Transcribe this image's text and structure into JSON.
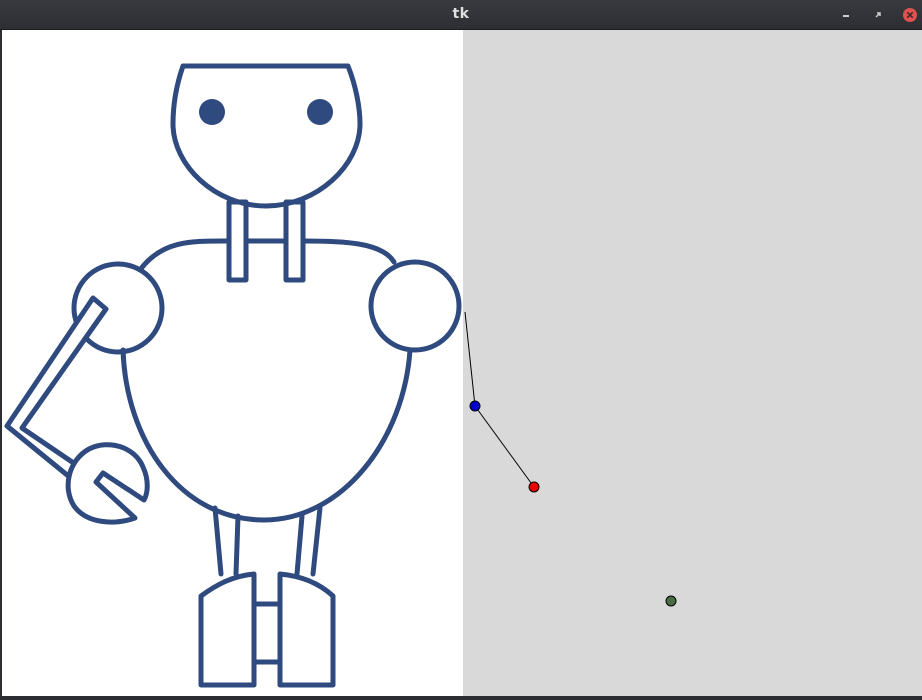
{
  "window": {
    "title": "tk",
    "buttons": {
      "minimize": "minimize-icon",
      "maximize": "maximize-icon",
      "close": "close-icon"
    }
  },
  "colors": {
    "titlebar": "#2f3035",
    "canvas_bg": "#d9d9d9",
    "image_bg": "#ffffff",
    "robot_stroke": "#2f4a7f",
    "close_button": "#e0514f",
    "point_blue": "#0000cc",
    "point_red": "#ee0000",
    "point_green": "#4a6b48"
  }
}
